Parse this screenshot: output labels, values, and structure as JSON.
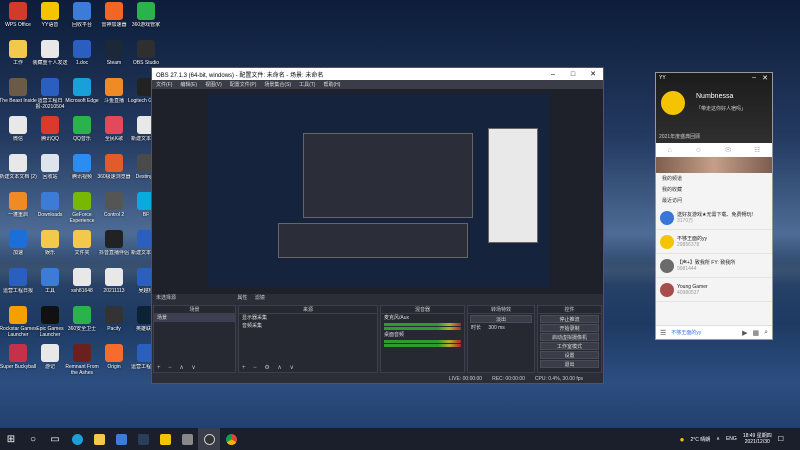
{
  "desktop": {
    "icons": [
      {
        "label": "WPS Office",
        "color": "#d23a2b"
      },
      {
        "label": "YY语音",
        "color": "#f5c400"
      },
      {
        "label": "回收平台",
        "color": "#3c7bd6"
      },
      {
        "label": "雷神加速器",
        "color": "#f26522"
      },
      {
        "label": "360游戏管家",
        "color": "#2bb24c"
      },
      {
        "label": "工作",
        "color": "#f2c94c"
      },
      {
        "label": "装藏重十人发送",
        "color": "#e8e8e8"
      },
      {
        "label": "1.doc",
        "color": "#2b5fbf"
      },
      {
        "label": "Steam",
        "color": "#1b2838"
      },
      {
        "label": "OBS Studio",
        "color": "#2f2f2f"
      },
      {
        "label": "The Beast Inside",
        "color": "#6b5a48"
      },
      {
        "label": "运营工程日报-20210504",
        "color": "#2b5fbf"
      },
      {
        "label": "Microsoft Edge",
        "color": "#1aa0d8"
      },
      {
        "label": "斗鱼直播",
        "color": "#f08a24"
      },
      {
        "label": "Logitech G HUB",
        "color": "#222"
      },
      {
        "label": "微信",
        "color": "#e8e8e8"
      },
      {
        "label": "腾讯QQ",
        "color": "#d93a2b"
      },
      {
        "label": "QQ音乐",
        "color": "#2bb24c"
      },
      {
        "label": "全民K歌",
        "color": "#e24a5b"
      },
      {
        "label": "新建文本文档",
        "color": "#e8e8e8"
      },
      {
        "label": "新建文本文档 (2)",
        "color": "#e8e8e8"
      },
      {
        "label": "回收站",
        "color": "#dde4ee"
      },
      {
        "label": "腾讯视频",
        "color": "#2d8cf0"
      },
      {
        "label": "360极速浏览器",
        "color": "#e25b2b"
      },
      {
        "label": "Destiny 2",
        "color": "#4a4a4a"
      },
      {
        "label": "一蓬重启",
        "color": "#f08a24"
      },
      {
        "label": "Downloads",
        "color": "#3c7bd6"
      },
      {
        "label": "GeForce Experience",
        "color": "#76b900"
      },
      {
        "label": "Control 2",
        "color": "#555"
      },
      {
        "label": "BF",
        "color": "#0aa9e0"
      },
      {
        "label": "加速",
        "color": "#1c6fd6"
      },
      {
        "label": "娱乐",
        "color": "#f2c94c"
      },
      {
        "label": "文件夹",
        "color": "#f2c94c"
      },
      {
        "label": "抖音直播伴侣",
        "color": "#222"
      },
      {
        "label": "新建文本文档",
        "color": "#2b5fbf"
      },
      {
        "label": "运营工程日报",
        "color": "#2b5fbf"
      },
      {
        "label": "工具",
        "color": "#3c7bd6"
      },
      {
        "label": "ssh81648",
        "color": "#e8e8e8"
      },
      {
        "label": "20211113",
        "color": "#e8e8e8"
      },
      {
        "label": "吴越桥",
        "color": "#2b5fbf"
      },
      {
        "label": "Rockstar Games Launcher",
        "color": "#f5a000"
      },
      {
        "label": "Epic Games Launcher",
        "color": "#111"
      },
      {
        "label": "360安全卫士",
        "color": "#2bb24c"
      },
      {
        "label": "Pacify",
        "color": "#333"
      },
      {
        "label": "英雄联盟",
        "color": "#0c2235"
      },
      {
        "label": "Super Buckyball",
        "color": "#c5304b"
      },
      {
        "label": "游记",
        "color": "#e8e8e8"
      },
      {
        "label": "Remnant From the Ashes",
        "color": "#6b2020"
      },
      {
        "label": "Origin",
        "color": "#f56c2d"
      },
      {
        "label": "运营工程日报",
        "color": "#2b5fbf"
      }
    ]
  },
  "obs": {
    "title": "OBS 27.1.3 (64-bit, windows) - 配置文件: 未命名 - 场景: 未命名",
    "menu": [
      "文件(F)",
      "编辑(E)",
      "视图(V)",
      "配置文件(P)",
      "场景集合(S)",
      "工具(T)",
      "帮助(H)"
    ],
    "docks_header": "未选择源",
    "scenes": {
      "title": "场景",
      "items": [
        "场景"
      ]
    },
    "sources": {
      "title": "来源",
      "items": [
        "显示器采集",
        "音频采集"
      ]
    },
    "mixer": {
      "title": "混音器",
      "tracks": [
        {
          "name": "麦克风/Aux",
          "value": "0.0 dB"
        },
        {
          "name": "桌面音频",
          "value": "0.0 dB"
        }
      ]
    },
    "transitions": {
      "title": "转场特效",
      "type": "淡出",
      "duration_label": "时长",
      "duration": "300 ms"
    },
    "controls": {
      "title": "控件",
      "buttons": [
        "停止推流",
        "开始录制",
        "启动虚拟摄像机",
        "工作室模式",
        "设置",
        "退出"
      ]
    },
    "status": {
      "live": "LIVE: 00:00:00",
      "rec": "REC: 00:00:00",
      "cpu": "CPU: 0.4%, 30.00 fps"
    },
    "props_label": "属性",
    "filters_label": "滤镜"
  },
  "yy": {
    "app": "YY",
    "username": "Numbnessa",
    "signature": "「带走这你好人宿吗」",
    "promo": "2021年度盛典回顾",
    "menu": [
      "我的频道",
      "我的收藏",
      "最近访问"
    ],
    "items": [
      {
        "line1": "送好友游戏★无需下载、免费畅玩!",
        "line2": "3170万",
        "color": "#3a76d8"
      },
      {
        "line1": "不够王面的yy",
        "line2": "29856378",
        "color": "#f5c400"
      },
      {
        "line1": "【声+】致我所  FY: 致我所",
        "line2": "9981444",
        "color": "#6b6b6b"
      },
      {
        "line1": "Young Gamer",
        "line2": "40980537",
        "color": "#a84d4d"
      },
      {
        "line1": "不够王面的yy",
        "line2": "",
        "color": "#f5c400"
      }
    ]
  },
  "taskbar": {
    "search_icon": "search-icon",
    "weather": "2°C 晴朗",
    "lang": "ENG",
    "time": "18:49 星期四",
    "date": "2021/12/30"
  }
}
